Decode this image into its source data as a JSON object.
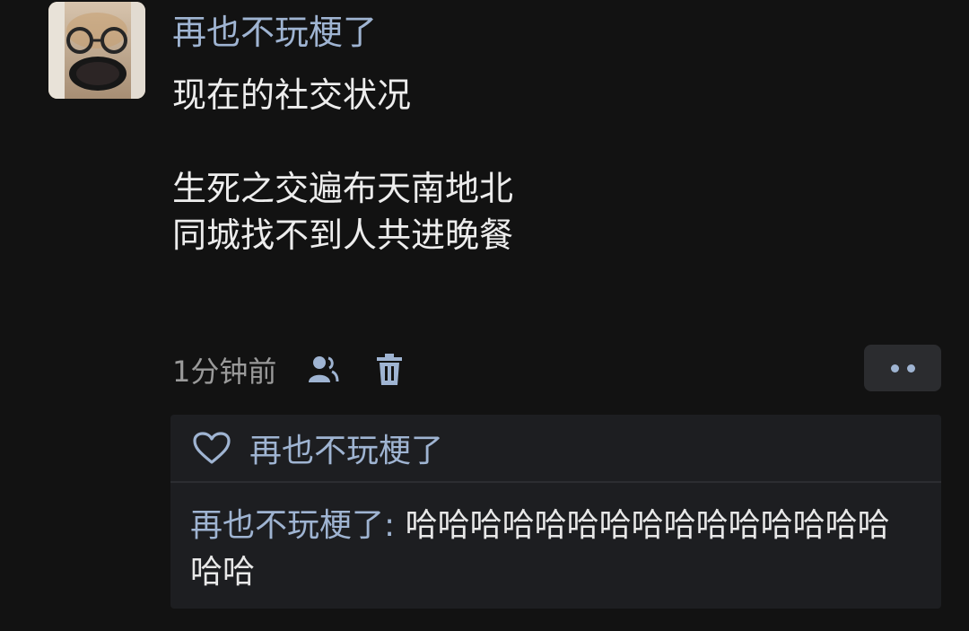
{
  "post": {
    "author": "再也不玩梗了",
    "lines": [
      "现在的社交状况",
      "",
      "生死之交遍布天南地北",
      "同城找不到人共进晚餐"
    ],
    "time": "1分钟前"
  },
  "likes": {
    "names": "再也不玩梗了"
  },
  "comment": {
    "author": "再也不玩梗了",
    "separator": ":",
    "text": "哈哈哈哈哈哈哈哈哈哈哈哈哈哈哈哈哈"
  },
  "icons": {
    "visibility": "friends-icon",
    "delete": "trash-icon",
    "more": "more-icon",
    "like": "heart-icon"
  },
  "colors": {
    "background": "#121212",
    "name": "#9fb4d2",
    "text": "#ededed",
    "meta": "#9a9a9a",
    "panel": "#1d1e21"
  }
}
